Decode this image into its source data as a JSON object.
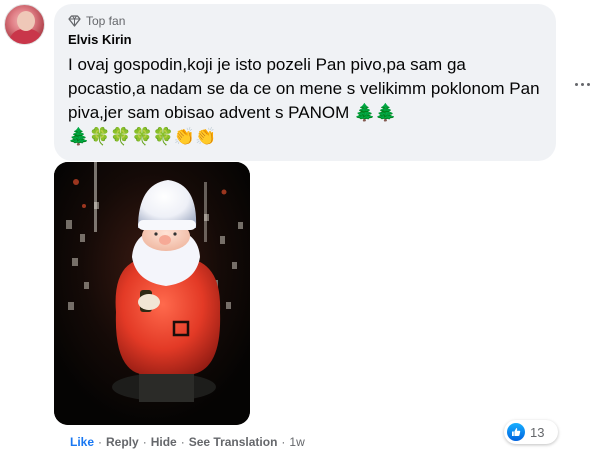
{
  "comment": {
    "badge_label": "Top fan",
    "author": "Elvis Kirin",
    "text": "I ovaj gospodin,koji je isto pozeli Pan pivo,pa sam ga pocastio,a nadam se da ce on mene s velikimm poklonom Pan piva,jer sam obisao advent s PANOM",
    "emoji_inline": "🌲🌲",
    "emoji_row": "🌲🍀🍀🍀🍀👏👏"
  },
  "actions": {
    "like": "Like",
    "reply": "Reply",
    "hide": "Hide",
    "see_translation": "See Translation",
    "separator": "·",
    "time": "1w"
  },
  "reactions": {
    "count": "13",
    "icon": "thumbs-up-icon",
    "color": "#1877f2"
  },
  "icons": {
    "badge": "diamond-icon",
    "more": "more-options-icon"
  }
}
